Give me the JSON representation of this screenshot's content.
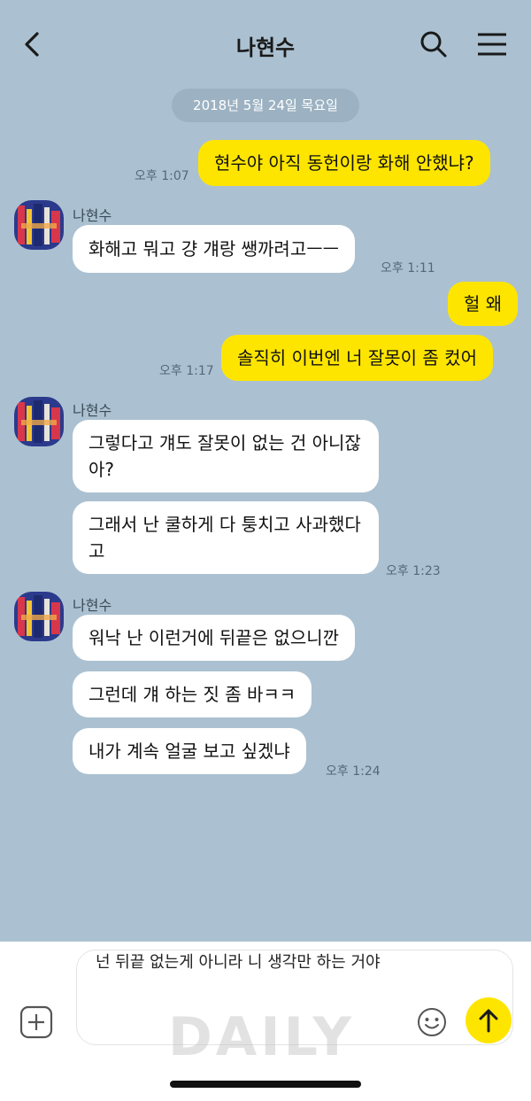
{
  "header": {
    "title": "나현수",
    "icons": {
      "back": "chevron-left-icon",
      "search": "search-icon",
      "menu": "hamburger-menu-icon"
    }
  },
  "date_divider": "2018년 5월 24일 목요일",
  "messages": [
    {
      "from": "me",
      "text": "현수야 아직 동헌이랑 화해 안했냐?",
      "time": "오후 1:07"
    },
    {
      "from": "other",
      "sender": "나현수",
      "text": "화해고 뭐고 걍 걔랑 쌩까려고ㅡㅡ",
      "time": "오후 1:11"
    },
    {
      "from": "me",
      "text": "헐 왜"
    },
    {
      "from": "me",
      "text": "솔직히 이번엔 너 잘못이 좀 컸어",
      "time": "오후 1:17"
    },
    {
      "from": "other",
      "sender": "나현수",
      "text": "그렇다고 걔도 잘못이 없는 건 아니잖아?"
    },
    {
      "from": "other",
      "text": "그래서 난 쿨하게 다 퉁치고 사과했다고",
      "time": "오후 1:23"
    },
    {
      "from": "other",
      "sender": "나현수",
      "text": "워낙 난 이런거에 뒤끝은 없으니깐"
    },
    {
      "from": "other",
      "text": "그런데 걔 하는 짓 좀 바ㅋㅋ"
    },
    {
      "from": "other",
      "text": "내가 계속 얼굴 보고 싶겠냐",
      "time": "오후 1:24"
    }
  ],
  "composer": {
    "value": "넌 뒤끝 없는게 아니라 니 생각만 하는 거야",
    "icons": {
      "attach": "plus-square-icon",
      "emoji": "smiley-icon",
      "send": "arrow-up-icon"
    }
  },
  "watermark": "DAILY",
  "colors": {
    "background": "#abc1d1",
    "my_bubble": "#fee500",
    "other_bubble": "#ffffff"
  }
}
